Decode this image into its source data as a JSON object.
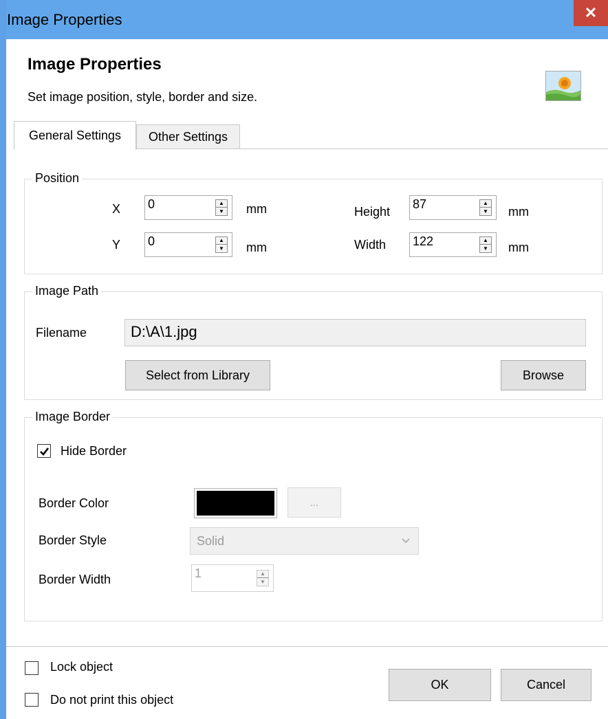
{
  "window": {
    "title": "Image Properties",
    "close_glyph": "✕"
  },
  "header": {
    "title": "Image Properties",
    "subtitle": "Set image position, style, border and size.",
    "icon": "image-landscape-icon"
  },
  "tabs": [
    {
      "label": "General Settings",
      "active": true
    },
    {
      "label": "Other Settings",
      "active": false
    }
  ],
  "position": {
    "legend": "Position",
    "x_label": "X",
    "x_value": "0",
    "x_unit": "mm",
    "y_label": "Y",
    "y_value": "0",
    "y_unit": "mm",
    "height_label": "Height",
    "height_value": "87",
    "height_unit": "mm",
    "width_label": "Width",
    "width_value": "122",
    "width_unit": "mm"
  },
  "image_path": {
    "legend": "Image Path",
    "filename_label": "Filename",
    "filename_value": "D:\\A\\1.jpg",
    "select_library_label": "Select from Library",
    "browse_label": "Browse"
  },
  "border": {
    "legend": "Image Border",
    "hide_border_label": "Hide Border",
    "hide_border_checked": true,
    "color_label": "Border Color",
    "color_value": "#000000",
    "color_button_label": "...",
    "style_label": "Border Style",
    "style_value": "Solid",
    "width_label": "Border Width",
    "width_value": "1"
  },
  "footer": {
    "lock_label": "Lock object",
    "lock_checked": false,
    "noprint_label": "Do not print this object",
    "noprint_checked": false,
    "ok_label": "OK",
    "cancel_label": "Cancel"
  },
  "colors": {
    "titlebar": "#61a6ea",
    "close_button": "#c7453b",
    "button_face": "#e1e1e1"
  }
}
